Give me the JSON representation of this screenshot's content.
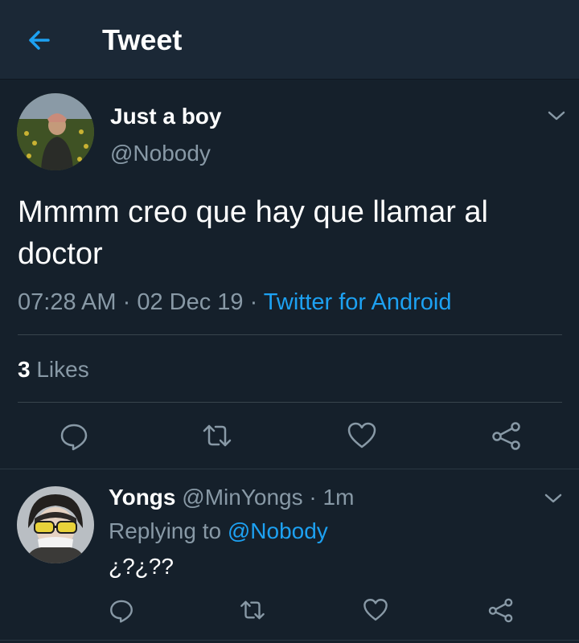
{
  "header": {
    "title": "Tweet"
  },
  "tweet": {
    "display_name": "Just a boy",
    "handle": "@Nobody",
    "text": "Mmmm creo que hay que llamar al doctor",
    "time": "07:28 AM",
    "separator1": " · ",
    "date": "02 Dec 19",
    "separator2": " · ",
    "source": "Twitter for Android",
    "likes_count": "3",
    "likes_label": " Likes"
  },
  "reply": {
    "display_name": "Yongs",
    "handle": " @MinYongs",
    "separator": " · ",
    "time": "1m",
    "replying_to_label": "Replying to ",
    "replying_to_handle": "@Nobody",
    "text": "¿?¿??"
  },
  "icons": {
    "back": "arrow-left-icon",
    "chevron": "chevron-down-icon",
    "reply": "comment-icon",
    "retweet": "retweet-icon",
    "like": "heart-icon",
    "share": "share-icon"
  },
  "colors": {
    "background": "#15202b",
    "header": "#1b2836",
    "accent": "#1da1f2",
    "secondary_text": "#8899a6",
    "divider": "#38444d"
  }
}
